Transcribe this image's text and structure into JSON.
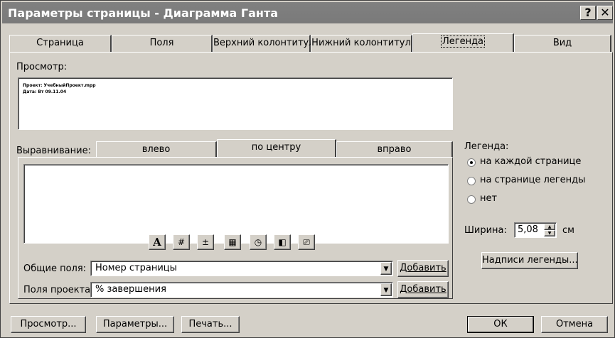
{
  "dialog": {
    "title": "Параметры страницы - Диаграмма Ганта",
    "help_glyph": "?",
    "close_glyph": "✕"
  },
  "tabs": [
    {
      "label": "Страница"
    },
    {
      "label": "Поля"
    },
    {
      "label": "Верхний колонтитул"
    },
    {
      "label": "Нижний колонтитул"
    },
    {
      "label": "Легенда",
      "active": true
    },
    {
      "label": "Вид"
    }
  ],
  "preview": {
    "label": "Просмотр:",
    "line1": "Проект: УчебныйПроект.mpp",
    "line2": "Дата: Вт 09.11.04"
  },
  "alignment": {
    "label": "Выравнивание:",
    "tabs": [
      "влево",
      "по центру",
      "вправо"
    ],
    "active_index": 1
  },
  "toolbar": {
    "icons": [
      "font-icon",
      "page-number-icon",
      "total-pages-icon",
      "date-icon",
      "time-icon",
      "file-name-icon",
      "insert-picture-icon"
    ],
    "glyphs": [
      "A",
      "#",
      "±",
      "▦",
      "◷",
      "◧",
      "⎚"
    ]
  },
  "common_fields": {
    "label": "Общие поля:",
    "value": "Номер страницы",
    "add_label": "Добавить"
  },
  "project_fields": {
    "label": "Поля проекта:",
    "value": "% завершения",
    "add_label": "Добавить"
  },
  "legend": {
    "label": "Легенда:",
    "options": [
      "на каждой странице",
      "на странице легенды",
      "нет"
    ],
    "selected_index": 0,
    "width_label": "Ширина:",
    "width_value": "5,08",
    "width_unit": "см",
    "captions_button": "Надписи легенды..."
  },
  "footer": {
    "preview_button": "Просмотр...",
    "options_button": "Параметры...",
    "print_button": "Печать...",
    "ok_button": "ОК",
    "cancel_button": "Отмена"
  }
}
